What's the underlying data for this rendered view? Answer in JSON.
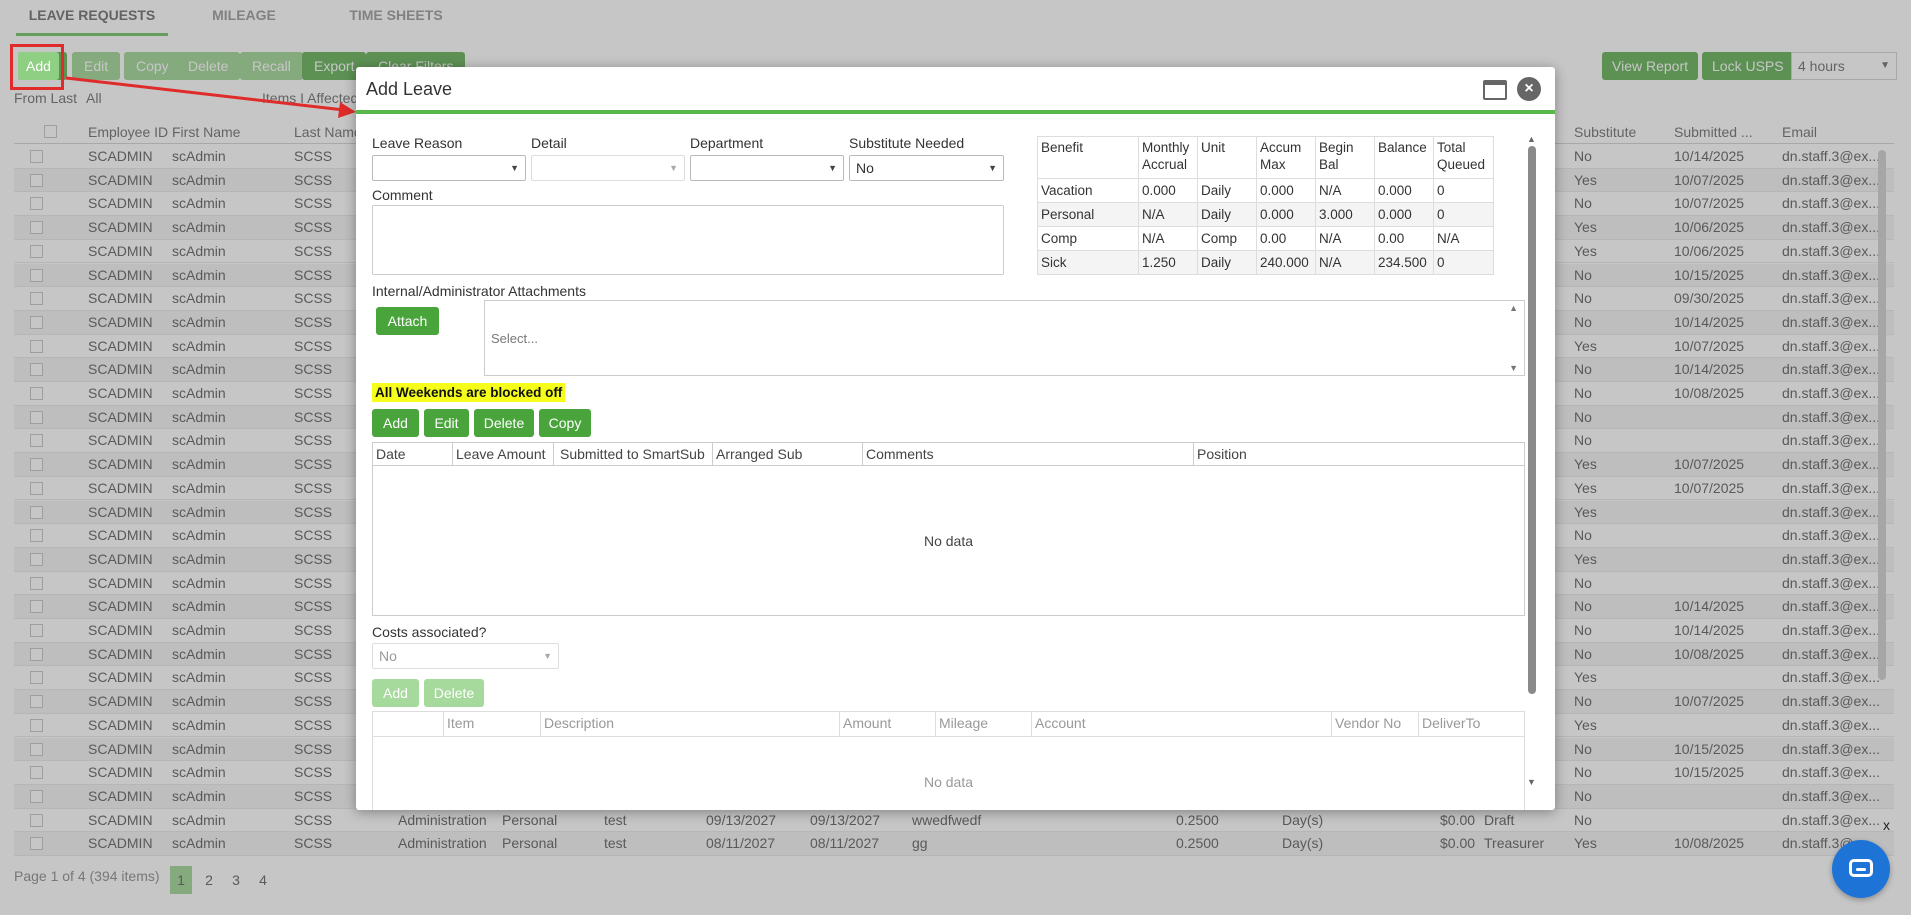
{
  "app": {
    "tabs": [
      {
        "label": "LEAVE REQUESTS",
        "active": true
      },
      {
        "label": "MILEAGE",
        "active": false
      },
      {
        "label": "TIME SHEETS",
        "active": false
      }
    ],
    "toolbar": [
      "Add",
      "Edit",
      "Copy",
      "Delete",
      "Recall",
      "Export",
      "Clear Filters"
    ],
    "right_buttons": [
      "View Report",
      "Lock USPS"
    ],
    "hours_select": "4 hours",
    "from_last_label": "From Last",
    "from_last_value": "All",
    "items_affected_label": "Items I Affected",
    "columns": [
      "Employee ID",
      "First Name",
      "Last Name",
      "Substitute",
      "Submitted ...",
      "Email"
    ],
    "rows": [
      {
        "emp": "SCADMIN",
        "first": "scAdmin",
        "last": "SCSS",
        "sub": "No",
        "date": "10/14/2025",
        "email": "dn.staff.3@ex..."
      },
      {
        "emp": "SCADMIN",
        "first": "scAdmin",
        "last": "SCSS",
        "sub": "Yes",
        "date": "10/07/2025",
        "email": "dn.staff.3@ex..."
      },
      {
        "emp": "SCADMIN",
        "first": "scAdmin",
        "last": "SCSS",
        "sub": "No",
        "date": "10/07/2025",
        "email": "dn.staff.3@ex..."
      },
      {
        "emp": "SCADMIN",
        "first": "scAdmin",
        "last": "SCSS",
        "sub": "Yes",
        "date": "10/06/2025",
        "email": "dn.staff.3@ex..."
      },
      {
        "emp": "SCADMIN",
        "first": "scAdmin",
        "last": "SCSS",
        "sub": "Yes",
        "date": "10/06/2025",
        "email": "dn.staff.3@ex..."
      },
      {
        "emp": "SCADMIN",
        "first": "scAdmin",
        "last": "SCSS",
        "sub": "No",
        "date": "10/15/2025",
        "email": "dn.staff.3@ex..."
      },
      {
        "emp": "SCADMIN",
        "first": "scAdmin",
        "last": "SCSS",
        "sub": "No",
        "date": "09/30/2025",
        "email": "dn.staff.3@ex..."
      },
      {
        "emp": "SCADMIN",
        "first": "scAdmin",
        "last": "SCSS",
        "sub": "No",
        "date": "10/14/2025",
        "email": "dn.staff.3@ex..."
      },
      {
        "emp": "SCADMIN",
        "first": "scAdmin",
        "last": "SCSS",
        "sub": "Yes",
        "date": "10/07/2025",
        "email": "dn.staff.3@ex..."
      },
      {
        "emp": "SCADMIN",
        "first": "scAdmin",
        "last": "SCSS",
        "sub": "No",
        "date": "10/14/2025",
        "email": "dn.staff.3@ex..."
      },
      {
        "emp": "SCADMIN",
        "first": "scAdmin",
        "last": "SCSS",
        "sub": "No",
        "date": "10/08/2025",
        "email": "dn.staff.3@ex..."
      },
      {
        "emp": "SCADMIN",
        "first": "scAdmin",
        "last": "SCSS",
        "sub": "No",
        "date": "",
        "email": "dn.staff.3@ex..."
      },
      {
        "emp": "SCADMIN",
        "first": "scAdmin",
        "last": "SCSS",
        "sub": "No",
        "date": "",
        "email": "dn.staff.3@ex..."
      },
      {
        "emp": "SCADMIN",
        "first": "scAdmin",
        "last": "SCSS",
        "sub": "Yes",
        "date": "10/07/2025",
        "email": "dn.staff.3@ex..."
      },
      {
        "emp": "SCADMIN",
        "first": "scAdmin",
        "last": "SCSS",
        "sub": "Yes",
        "date": "10/07/2025",
        "email": "dn.staff.3@ex..."
      },
      {
        "emp": "SCADMIN",
        "first": "scAdmin",
        "last": "SCSS",
        "sub": "Yes",
        "date": "",
        "email": "dn.staff.3@ex..."
      },
      {
        "emp": "SCADMIN",
        "first": "scAdmin",
        "last": "SCSS",
        "sub": "No",
        "date": "",
        "email": "dn.staff.3@ex..."
      },
      {
        "emp": "SCADMIN",
        "first": "scAdmin",
        "last": "SCSS",
        "sub": "Yes",
        "date": "",
        "email": "dn.staff.3@ex..."
      },
      {
        "emp": "SCADMIN",
        "first": "scAdmin",
        "last": "SCSS",
        "sub": "No",
        "date": "",
        "email": "dn.staff.3@ex..."
      },
      {
        "emp": "SCADMIN",
        "first": "scAdmin",
        "last": "SCSS",
        "sub": "No",
        "date": "10/14/2025",
        "email": "dn.staff.3@ex..."
      },
      {
        "emp": "SCADMIN",
        "first": "scAdmin",
        "last": "SCSS",
        "sub": "No",
        "date": "10/14/2025",
        "email": "dn.staff.3@ex..."
      },
      {
        "emp": "SCADMIN",
        "first": "scAdmin",
        "last": "SCSS",
        "sub": "No",
        "date": "10/08/2025",
        "email": "dn.staff.3@ex..."
      },
      {
        "emp": "SCADMIN",
        "first": "scAdmin",
        "last": "SCSS",
        "sub": "Yes",
        "date": "",
        "email": "dn.staff.3@ex..."
      },
      {
        "emp": "SCADMIN",
        "first": "scAdmin",
        "last": "SCSS",
        "sub": "No",
        "date": "10/07/2025",
        "email": "dn.staff.3@ex..."
      },
      {
        "emp": "SCADMIN",
        "first": "scAdmin",
        "last": "SCSS",
        "sub": "Yes",
        "date": "",
        "email": "dn.staff.3@ex..."
      },
      {
        "emp": "SCADMIN",
        "first": "scAdmin",
        "last": "SCSS",
        "sub": "No",
        "date": "10/15/2025",
        "email": "dn.staff.3@ex..."
      },
      {
        "emp": "SCADMIN",
        "first": "scAdmin",
        "last": "SCSS",
        "sub": "No",
        "date": "10/15/2025",
        "email": "dn.staff.3@ex..."
      },
      {
        "emp": "SCADMIN",
        "first": "scAdmin",
        "last": "SCSS",
        "sub": "No",
        "date": "",
        "email": "dn.staff.3@ex..."
      },
      {
        "emp": "SCADMIN",
        "first": "scAdmin",
        "last": "SCSS",
        "dept": "Administration",
        "reason": "Personal",
        "detail": "test",
        "start": "09/13/2027",
        "end": "09/13/2027",
        "comment": "wwedfwedf",
        "amount": "0.2500",
        "unit": "Day(s)",
        "cost": "$0.00",
        "status": "Draft",
        "sub": "No",
        "date": "",
        "email": "dn.staff.3@ex..."
      },
      {
        "emp": "SCADMIN",
        "first": "scAdmin",
        "last": "SCSS",
        "dept": "Administration",
        "reason": "Personal",
        "detail": "test",
        "start": "08/11/2027",
        "end": "08/11/2027",
        "comment": "gg",
        "amount": "0.2500",
        "unit": "Day(s)",
        "cost": "$0.00",
        "status": "Treasurer",
        "sub": "Yes",
        "date": "10/08/2025",
        "email": "dn.staff.3@ex..."
      }
    ],
    "pager_text": "Page 1 of 4 (394 items)",
    "pages": [
      "1",
      "2",
      "3",
      "4"
    ]
  },
  "dialog": {
    "title": "Add Leave",
    "labels": {
      "leave_reason": "Leave Reason",
      "detail": "Detail",
      "department": "Department",
      "substitute_needed": "Substitute Needed",
      "comment": "Comment",
      "attachments": "Internal/Administrator Attachments",
      "costs": "Costs associated?"
    },
    "values": {
      "leave_reason": "",
      "detail": "",
      "department": "",
      "substitute_needed": "No",
      "costs": "No"
    },
    "benefit_table": {
      "headers": [
        "Benefit",
        "Monthly Accrual",
        "Unit",
        "Accum Max",
        "Begin Bal",
        "Balance",
        "Total Queued"
      ],
      "rows": [
        [
          "Vacation",
          "0.000",
          "Daily",
          "0.000",
          "N/A",
          "0.000",
          "0"
        ],
        [
          "Personal",
          "N/A",
          "Daily",
          "0.000",
          "3.000",
          "0.000",
          "0"
        ],
        [
          "Comp",
          "N/A",
          "Comp",
          "0.00",
          "N/A",
          "0.00",
          "N/A"
        ],
        [
          "Sick",
          "1.250",
          "Daily",
          "240.000",
          "N/A",
          "234.500",
          "0"
        ]
      ]
    },
    "attach_label": "Attach",
    "attach_placeholder": "Select...",
    "warning": "All Weekends are blocked off",
    "leave_buttons": [
      "Add",
      "Edit",
      "Delete",
      "Copy"
    ],
    "leave_columns": [
      "Date",
      "Leave Amount",
      "Submitted to SmartSub",
      "Arranged Sub",
      "Comments",
      "Position"
    ],
    "no_data": "No data",
    "cost_buttons": [
      "Add",
      "Delete"
    ],
    "cost_columns": [
      "",
      "Item",
      "Description",
      "Amount",
      "Mileage",
      "Account",
      "Vendor No",
      "DeliverTo"
    ],
    "cost_no_data": "No data"
  },
  "chat": {
    "close": "x"
  },
  "colors": {
    "accent": "#58b94a",
    "button": "#4aa43c",
    "highlight": "#e02b2b",
    "warning_bg": "#f6ff1a",
    "chat": "#1e74d6"
  }
}
